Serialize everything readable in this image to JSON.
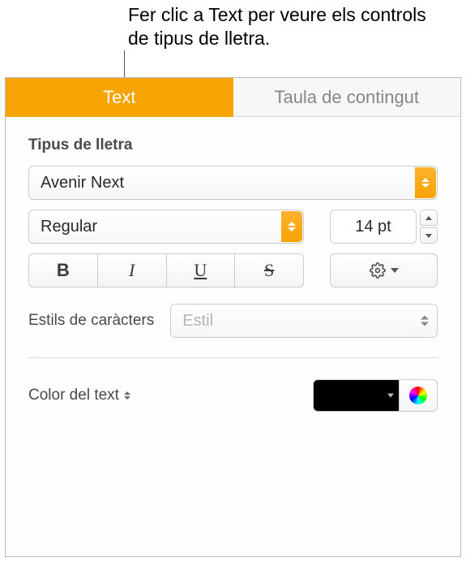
{
  "callout": "Fer clic a Text per veure els controls de tipus de lletra.",
  "tabs": {
    "text": "Text",
    "toc": "Taula de contingut"
  },
  "font": {
    "section_label": "Tipus de lletra",
    "family": "Avenir Next",
    "style": "Regular",
    "size": "14 pt",
    "buttons": {
      "bold": "B",
      "italic": "I",
      "underline": "U",
      "strike": "S"
    }
  },
  "char_styles": {
    "label": "Estils de caràcters",
    "value": "Estil"
  },
  "text_color": {
    "label": "Color del text",
    "value": "#000000"
  }
}
